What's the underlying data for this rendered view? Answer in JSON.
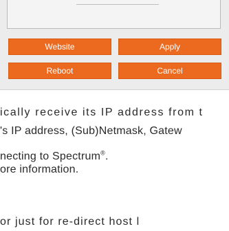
{
  "dialog": {
    "buttons": {
      "website": "Website",
      "apply": "Apply",
      "reboot": "Reboot",
      "cancel": "Cancel"
    }
  },
  "document": {
    "line1": "ically receive its IP address from t",
    "line2": "'s IP address, (Sub)Netmask, Gatew",
    "line3_text": "necting to Spectrum",
    "line3_sup": "®",
    "line3_end": ".",
    "line4": "ore information.",
    "line5": "or just for re-direct host l"
  },
  "colors": {
    "button": "#ec6a1f",
    "panel": "#ececec"
  }
}
